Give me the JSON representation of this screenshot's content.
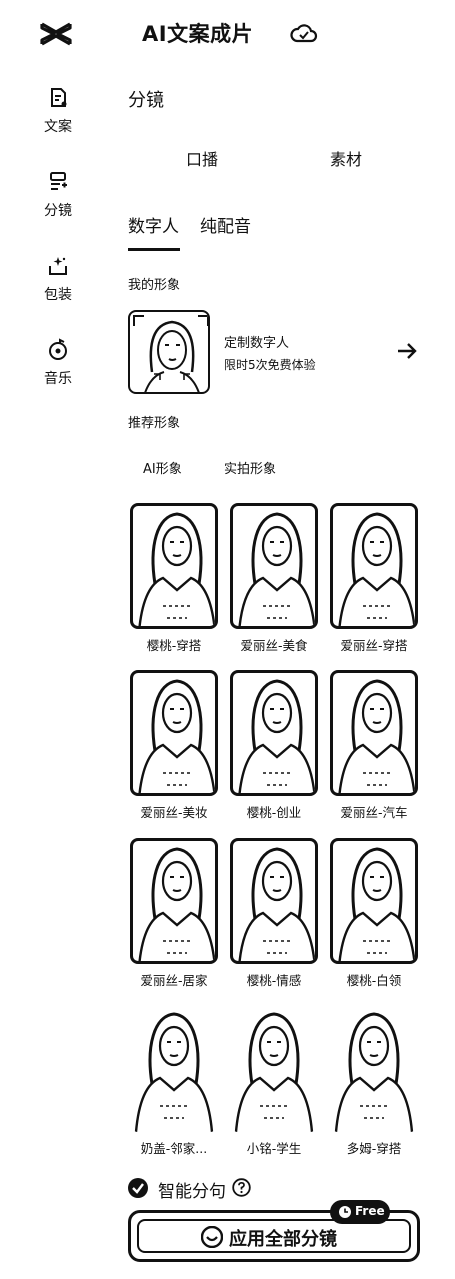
{
  "header": {
    "title": "AI文案成片"
  },
  "sidebar": {
    "items": [
      {
        "label": "文案",
        "icon": "document-ai-icon"
      },
      {
        "label": "分镜",
        "icon": "storyboard-icon"
      },
      {
        "label": "包装",
        "icon": "sparkle-package-icon"
      },
      {
        "label": "音乐",
        "icon": "music-disc-icon"
      }
    ]
  },
  "main": {
    "section_title": "分镜",
    "modes": [
      "口播",
      "素材"
    ],
    "tabs": [
      "数字人",
      "纯配音"
    ],
    "my_avatar_label": "我的形象",
    "custom_card": {
      "title": "定制数字人",
      "subtitle": "限时5次免费体验"
    },
    "recommend_label": "推荐形象",
    "subtabs": [
      "AI形象",
      "实拍形象"
    ],
    "avatars": [
      "樱桃-穿搭",
      "爱丽丝-美食",
      "爱丽丝-穿搭",
      "爱丽丝-美妆",
      "樱桃-创业",
      "爱丽丝-汽车",
      "爱丽丝-居家",
      "樱桃-情感",
      "樱桃-白领",
      "奶盖-邻家...",
      "小铭-学生",
      "多姆-穿搭"
    ],
    "smart_split": {
      "label": "智能分句",
      "checked": true
    },
    "apply_button": {
      "label": "应用全部分镜",
      "badge": "Free"
    }
  }
}
